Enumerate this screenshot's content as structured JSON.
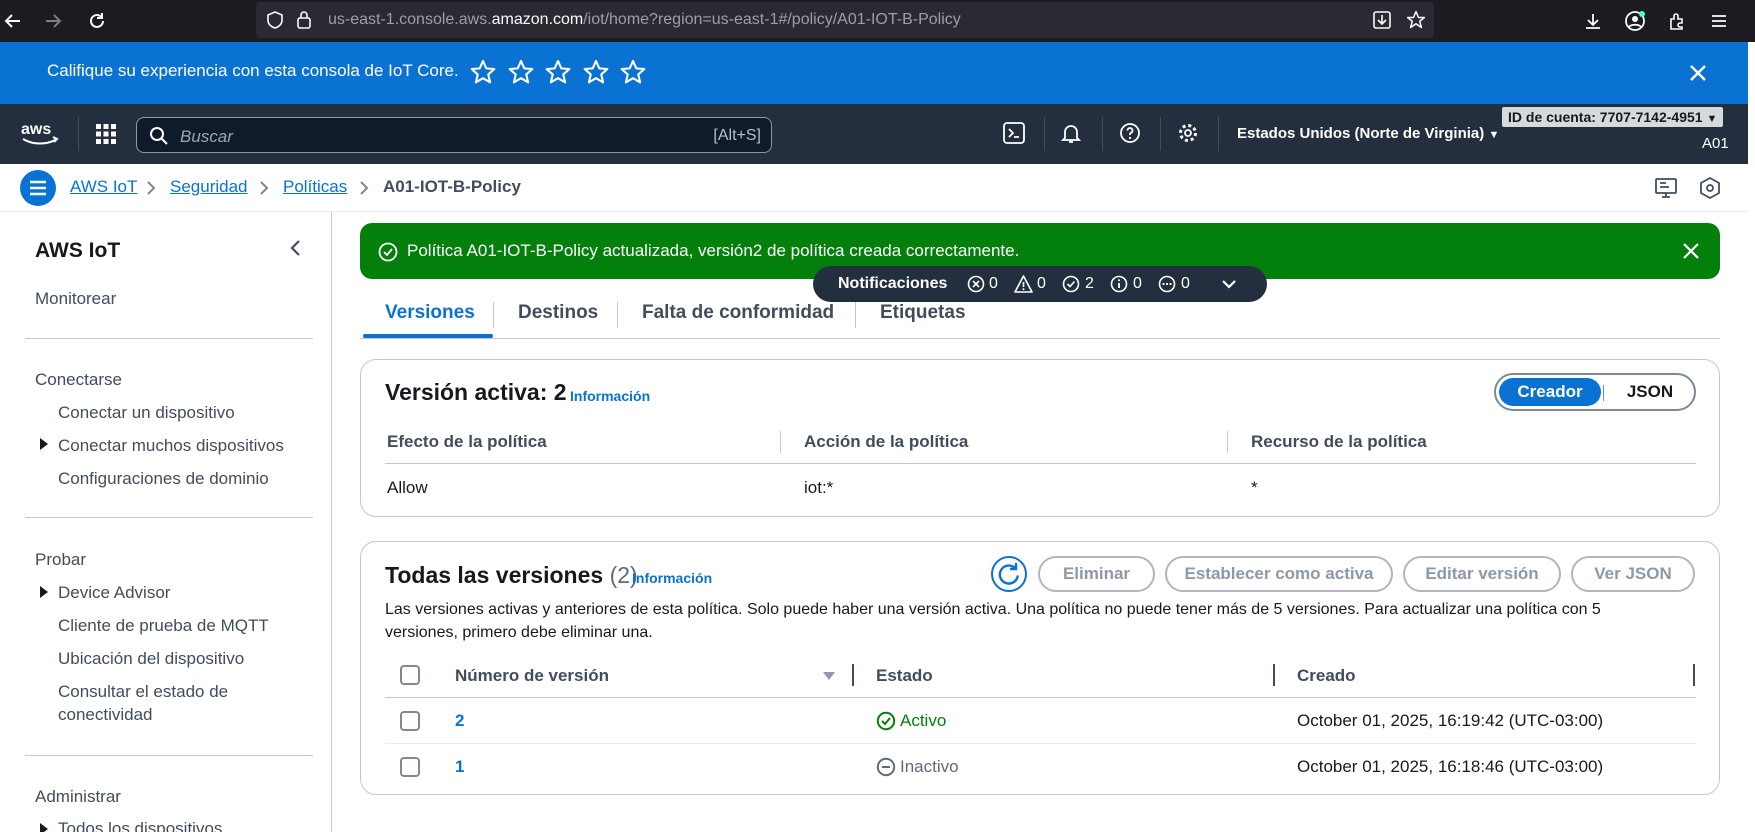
{
  "browser": {
    "url_prefix": "us-east-1.console.aws.",
    "url_domain": "amazon.com",
    "url_suffix": "/iot/home?region=us-east-1#/policy/A01-IOT-B-Policy"
  },
  "feedback": {
    "text": "Califique su experiencia con esta consola de IoT Core.",
    "stars": 5
  },
  "topnav": {
    "search_placeholder": "Buscar",
    "search_shortcut": "[Alt+S]",
    "region": "Estados Unidos (Norte de Virginia)",
    "account": "ID de cuenta: 7707-7142-4951",
    "user": "A01"
  },
  "breadcrumb": {
    "items": [
      "AWS IoT",
      "Seguridad",
      "Políticas"
    ],
    "current": "A01-IOT-B-Policy"
  },
  "sidebar": {
    "title": "AWS IoT",
    "monitor": "Monitorear",
    "connect_header": "Conectarse",
    "connect_items": [
      "Conectar un dispositivo",
      "Conectar muchos dispositivos",
      "Configuraciones de dominio"
    ],
    "test_header": "Probar",
    "test_items": [
      "Device Advisor",
      "Cliente de prueba de MQTT",
      "Ubicación del dispositivo",
      "Consultar el estado de",
      "conectividad"
    ],
    "manage_header": "Administrar",
    "manage_items": [
      "Todos los dispositivos"
    ]
  },
  "success": {
    "message": "Política A01-IOT-B-Policy actualizada, versión2 de política creada correctamente."
  },
  "notifications": {
    "label": "Notificaciones",
    "error": "0",
    "warning": "0",
    "success": "2",
    "info": "0",
    "progress": "0"
  },
  "tabs": [
    "Versiones",
    "Destinos",
    "Falta de conformidad",
    "Etiquetas"
  ],
  "active_version": {
    "title": "Versión activa: 2",
    "info": "Información",
    "toggle_on": "Creador",
    "toggle_off": "JSON",
    "headers": [
      "Efecto de la política",
      "Acción de la política",
      "Recurso de la política"
    ],
    "row": [
      "Allow",
      "iot:*",
      "*"
    ]
  },
  "all_versions": {
    "title": "Todas las versiones",
    "count": "(2)",
    "info": "Información",
    "buttons": [
      "Eliminar",
      "Establecer como activa",
      "Editar versión",
      "Ver JSON"
    ],
    "description_line1": "Las versiones activas y anteriores de esta política. Solo puede haber una versión activa. Una política no puede tener más de 5 versiones. Para actualizar una política con 5",
    "description_line2": "versiones, primero debe eliminar una.",
    "headers": [
      "Número de versión",
      "Estado",
      "Creado"
    ],
    "rows": [
      {
        "version": "2",
        "status": "Activo",
        "created": "October 01, 2025, 16:19:42 (UTC-03:00)"
      },
      {
        "version": "1",
        "status": "Inactivo",
        "created": "October 01, 2025, 16:18:46 (UTC-03:00)"
      }
    ]
  },
  "colors": {
    "primary": "#0972d3",
    "success": "#037f0c",
    "nav": "#232f3e",
    "browser": "#1c1b22"
  }
}
